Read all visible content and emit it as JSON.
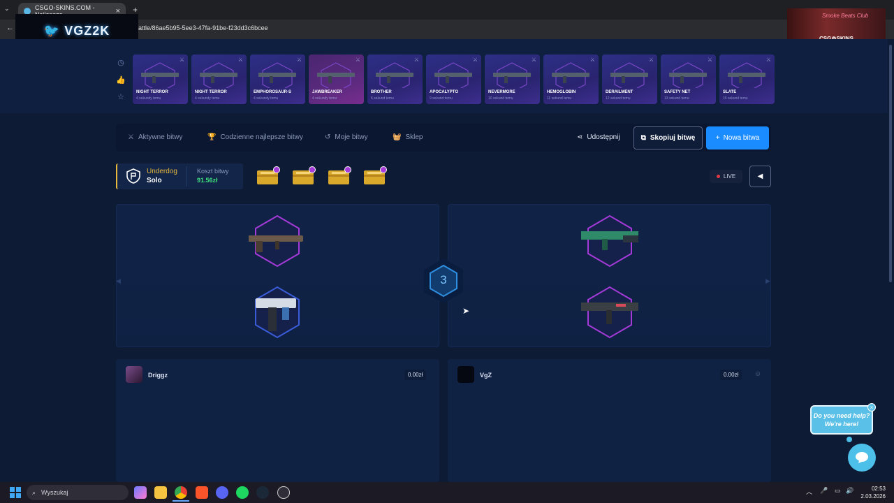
{
  "browser": {
    "tab_title": "CSGO-SKINS.COM - Najlepsze",
    "url": "attle/86ae5b95-5ee3-47fa-91be-f23dd3c6bcee"
  },
  "stream_overlay": {
    "logo_text": "VGZ2K",
    "cam_brand": "CSG⚙SKINS",
    "cam_neon": "Smoke Beats Club"
  },
  "live_drops": [
    {
      "name": "NIGHT TERROR",
      "time": "4 sekundy temu",
      "accent": "#2c2f86"
    },
    {
      "name": "NIGHT TERROR",
      "time": "4 sekundy temu",
      "accent": "#2c2f86"
    },
    {
      "name": "EMPHOROSAUR-S",
      "time": "4 sekundy temu",
      "accent": "#2c2f86"
    },
    {
      "name": "JAWBREAKER",
      "time": "4 sekundy temu",
      "accent": "#5a2a7e"
    },
    {
      "name": "BROTHER",
      "time": "6 sekund temu",
      "accent": "#2c2f86"
    },
    {
      "name": "APOCALYPTO",
      "time": "9 sekund temu",
      "accent": "#2c2f86"
    },
    {
      "name": "NEVERMORE",
      "time": "10 sekund temu",
      "accent": "#2c2f86"
    },
    {
      "name": "HEMOGLOBIN",
      "time": "11 sekund temu",
      "accent": "#2c2f86"
    },
    {
      "name": "DERAILMENT",
      "time": "12 sekund temu",
      "accent": "#2c2f86"
    },
    {
      "name": "SAFETY NET",
      "time": "13 sekund temu",
      "accent": "#2c2f86"
    },
    {
      "name": "SLATE",
      "time": "15 sekund temu",
      "accent": "#2c2f86"
    }
  ],
  "nav": {
    "active": "Aktywne bitwy",
    "daily": "Codzienne najlepsze bitwy",
    "mine": "Moje bitwy",
    "shop": "Sklep",
    "share": "Udostępnij",
    "copy": "Skopiuj bitwę",
    "new": "Nowa bitwa"
  },
  "battle": {
    "mode_title": "Underdog",
    "mode_sub": "Solo",
    "cost_label": "Koszt bitwy",
    "cost_value": "91.56zł",
    "live": "LIVE",
    "round": "3",
    "case_count": 4
  },
  "players": [
    {
      "name": "Driggz",
      "value": "0.00zł"
    },
    {
      "name": "VgZ",
      "value": "0.00zł"
    }
  ],
  "help": {
    "line1": "Do you need help?",
    "line2": "We're here!"
  },
  "taskbar": {
    "search": "Wyszukaj",
    "time": "02:53",
    "date": "2.03.2026"
  },
  "colors": {
    "accent_blue": "#1a8cff",
    "cost_green": "#3ee07a",
    "underdog_gold": "#e8b93a",
    "hex_purple": "#a43ad8",
    "hex_blue": "#3a5cd8"
  }
}
